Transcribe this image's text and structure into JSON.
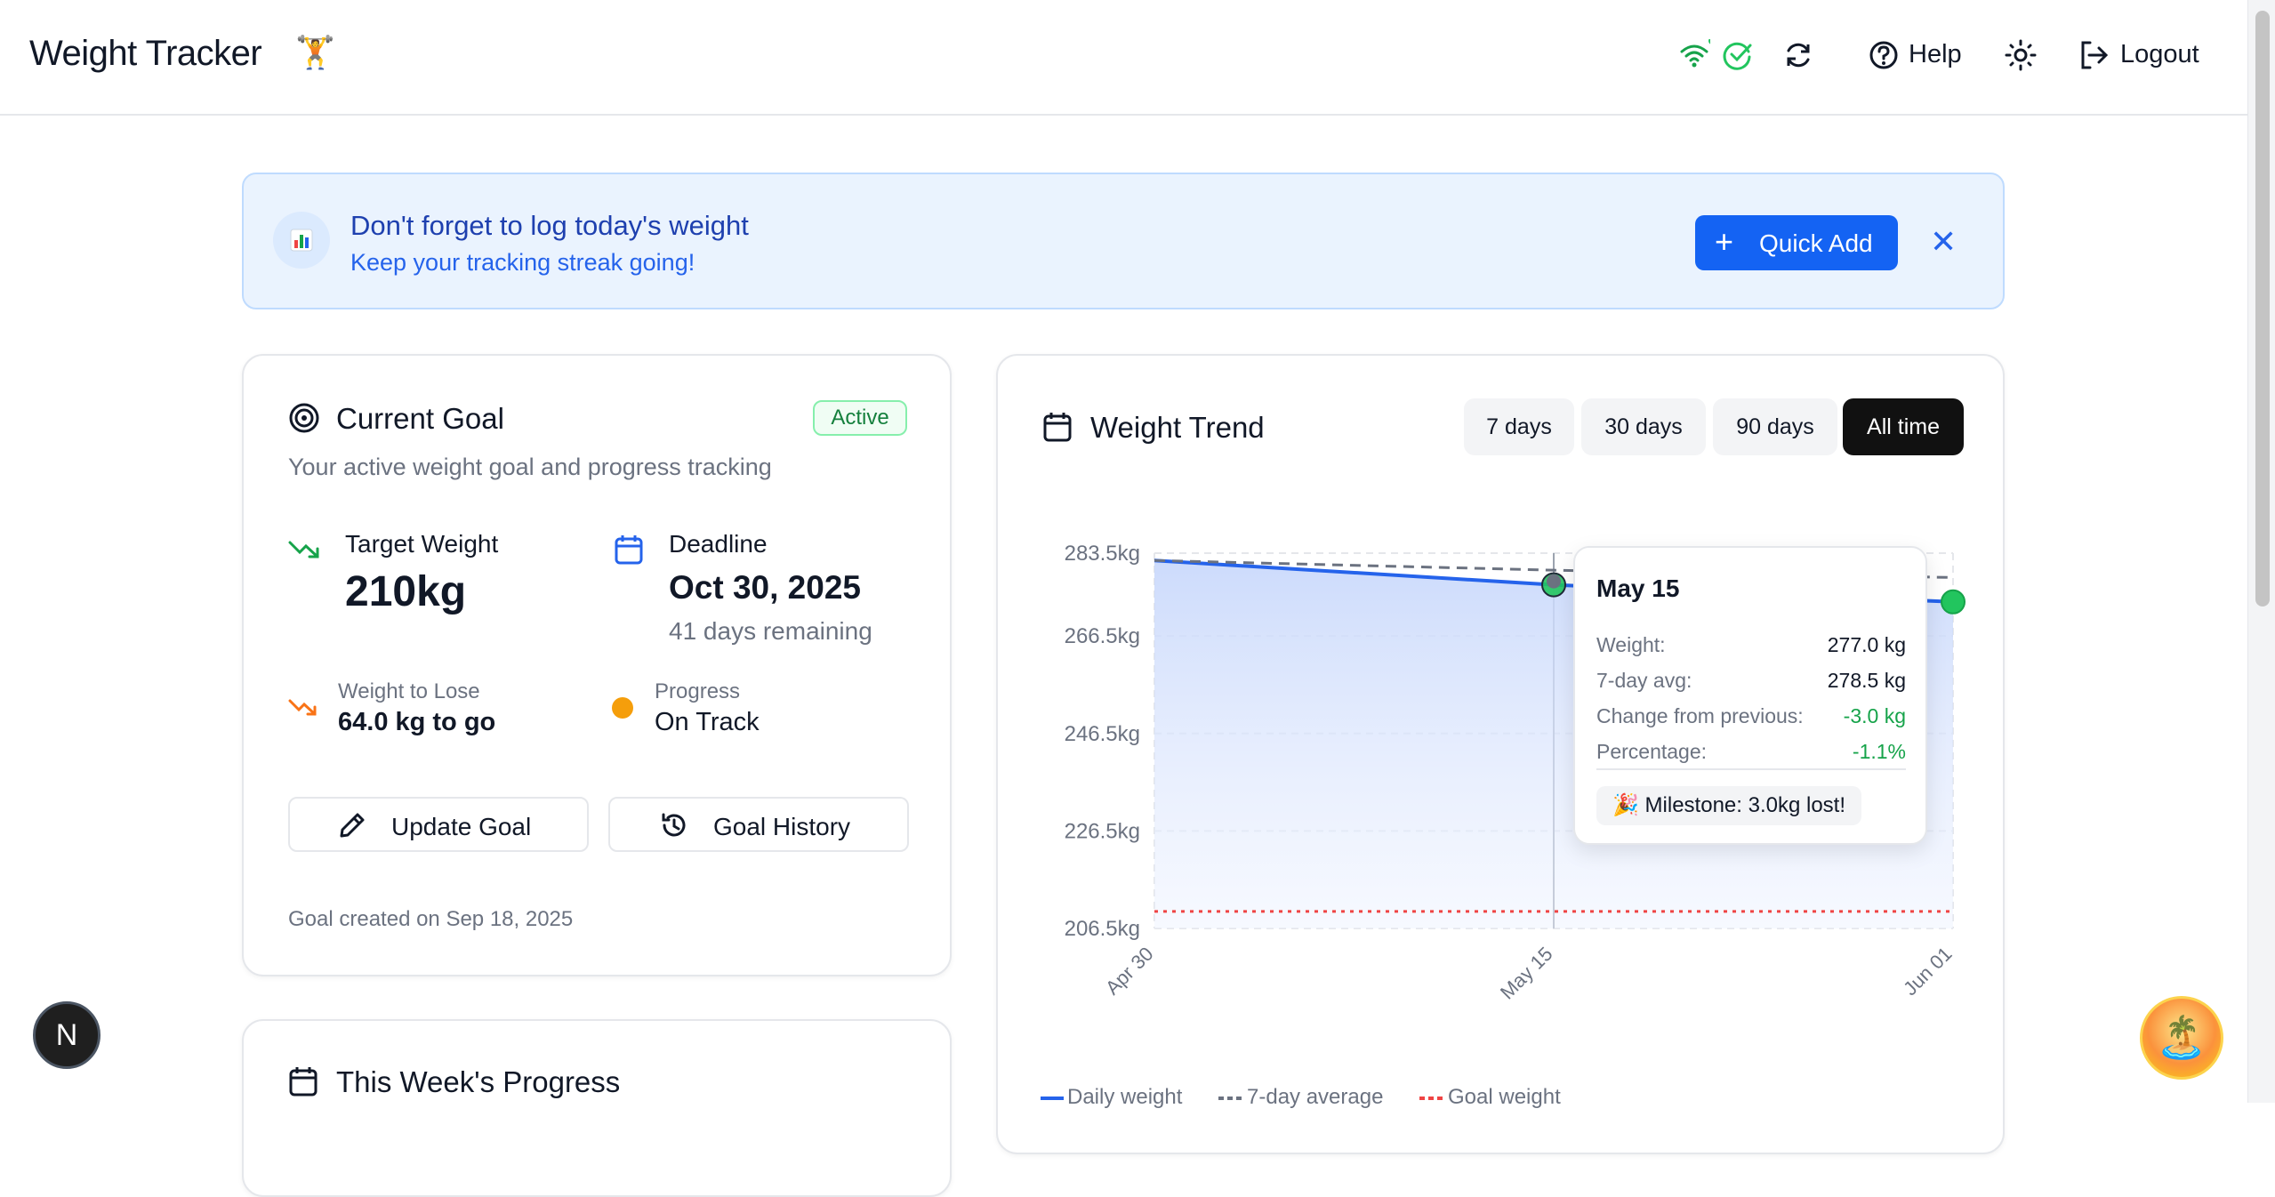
{
  "app": {
    "title": "Weight Tracker",
    "title_emoji": "🏋️"
  },
  "header": {
    "status_icons": [
      "wifi-icon",
      "check-circle-icon"
    ],
    "refresh_icon": "refresh-icon",
    "help_label": "Help",
    "theme_icon": "sun-icon",
    "logout_label": "Logout"
  },
  "banner": {
    "title": "Don't forget to log today's weight",
    "subtitle": "Keep your tracking streak going!",
    "quick_add_label": "Quick Add",
    "colors": {
      "accent": "#1463f3",
      "background": "#eaf3fe"
    }
  },
  "goal": {
    "title": "Current Goal",
    "status": "Active",
    "subtitle": "Your active weight goal and progress tracking",
    "target_label": "Target Weight",
    "target_value": "210kg",
    "deadline_label": "Deadline",
    "deadline_value": "Oct 30, 2025",
    "days_remaining": "41 days remaining",
    "to_lose_label": "Weight to Lose",
    "to_lose_value": "64.0 kg to go",
    "progress_label": "Progress",
    "progress_value": "On Track",
    "update_label": "Update Goal",
    "history_label": "Goal History",
    "created": "Goal created on Sep 18, 2025"
  },
  "week": {
    "title": "This Week's Progress"
  },
  "trend": {
    "title": "Weight Trend",
    "ranges": [
      "7 days",
      "30 days",
      "90 days",
      "All time"
    ],
    "active_range": "All time"
  },
  "tooltip": {
    "date": "May 15",
    "rows": [
      {
        "label": "Weight:",
        "value": "277.0 kg",
        "color": "default"
      },
      {
        "label": "7-day avg:",
        "value": "278.5 kg",
        "color": "default"
      },
      {
        "label": "Change from previous:",
        "value": "-3.0 kg",
        "color": "green"
      },
      {
        "label": "Percentage:",
        "value": "-1.1%",
        "color": "green"
      }
    ],
    "milestone": "🎉 Milestone: 3.0kg lost!"
  },
  "chart_data": {
    "type": "area",
    "x": [
      "Apr 30",
      "May 15",
      "Jun 01"
    ],
    "y_ticks": [
      "283.5kg",
      "266.5kg",
      "246.5kg",
      "226.5kg",
      "206.5kg"
    ],
    "ylim": [
      206.5,
      283.5
    ],
    "grid": true,
    "series": [
      {
        "name": "Daily weight",
        "color": "#2563eb",
        "values": [
          282.0,
          277.0,
          273.5
        ]
      },
      {
        "name": "7-day average",
        "color": "#6b7280",
        "style": "dashed",
        "values": [
          282.0,
          280.0,
          278.5
        ]
      },
      {
        "name": "Goal weight",
        "color": "#ef4444",
        "style": "dotted",
        "values": [
          210,
          210,
          210
        ]
      }
    ],
    "legend_position": "bottom-left"
  },
  "floating": {
    "left_label": "N"
  }
}
